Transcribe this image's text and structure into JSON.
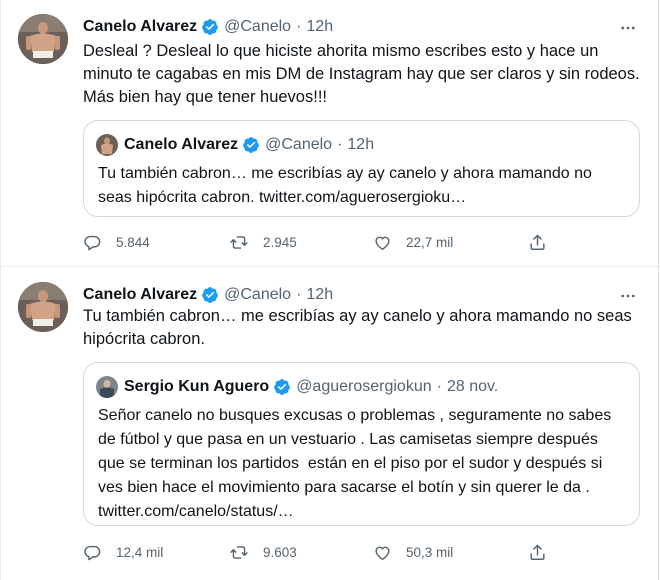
{
  "tweets": [
    {
      "author": "Canelo Alvarez",
      "handle": "@Canelo",
      "separator": "·",
      "time": "12h",
      "text_lines": [
        "Desleal ? Desleal lo que hiciste ahorita mismo escribes esto y hace un",
        "minuto te cagabas en mis DM de Instagram hay que ser claros y sin rodeos.",
        "Más bien hay que tener huevos!!!"
      ],
      "quote": {
        "author": "Canelo Alvarez",
        "handle": "@Canelo",
        "separator": "·",
        "time": "12h",
        "text_lines": [
          "Tu también cabron… me escribías ay ay canelo y ahora mamando no",
          "seas hipócrita cabron. twitter.com/aguerosergioku…"
        ]
      },
      "stats": {
        "replies": "5.844",
        "retweets": "2.945",
        "likes": "22,7 mil"
      }
    },
    {
      "author": "Canelo Alvarez",
      "handle": "@Canelo",
      "separator": "·",
      "time": "12h",
      "text_lines": [
        "Tu también cabron… me escribías ay ay canelo y ahora mamando no seas",
        "hipócrita cabron."
      ],
      "quote": {
        "author": "Sergio Kun Aguero",
        "handle": "@aguerosergiokun",
        "separator": "·",
        "time": "28 nov.",
        "text_lines": [
          "Señor canelo no busques excusas o problemas , seguramente no sabes",
          "de fútbol y que pasa en un vestuario . Las camisetas siempre después",
          "que se terminan los partidos  están en el piso por el sudor y después si",
          "ves bien hace el movimiento para sacarse el botín y sin querer le da .",
          "twitter.com/canelo/status/…"
        ]
      },
      "stats": {
        "replies": "12,4 mil",
        "retweets": "9.603",
        "likes": "50,3 mil"
      }
    }
  ],
  "colors": {
    "verified": "#1d9bf0",
    "secondary_text": "#536471",
    "border": "#cfd9de"
  },
  "icons": [
    "verified-badge-icon",
    "more-icon",
    "reply-icon",
    "retweet-icon",
    "like-icon",
    "share-icon"
  ]
}
